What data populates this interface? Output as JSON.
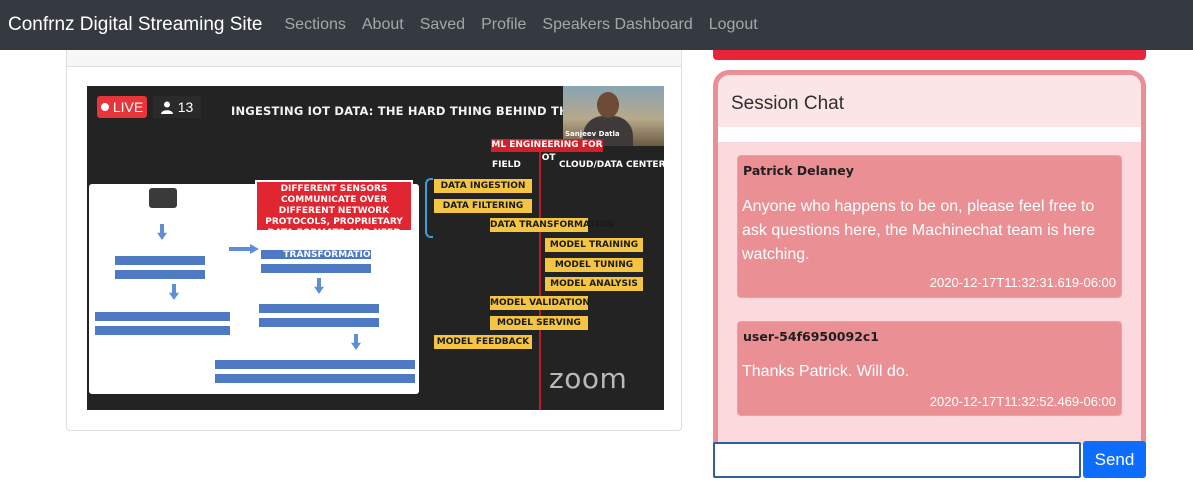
{
  "navbar": {
    "brand": "Confrnz Digital Streaming Site",
    "links": [
      "Sections",
      "About",
      "Saved",
      "Profile",
      "Speakers Dashboard",
      "Logout"
    ]
  },
  "video": {
    "live_label": "LIVE",
    "viewer_icon": "person-icon",
    "viewer_count": "13",
    "slide_title": "INGESTING IOT DATA: THE HARD THING BEHIND THE SMART THINGS",
    "speaker_name": "Sanjeev Datla",
    "ml_header": "ML ENGINEERING FOR IOT",
    "col_field": "FIELD",
    "col_cloud": "CLOUD/DATA CENTER",
    "callout": "DIFFERENT SENSORS COMMUNICATE OVER DIFFERENT NETWORK PROTOCOLS, PROPRIETARY DATA FORMATS AND NEED CUSTOM DATA TRANSFORMATIONS",
    "steps": [
      "DATA INGESTION",
      "DATA FILTERING",
      "DATA TRANSFORMATION",
      "MODEL TRAINING",
      "MODEL TUNING",
      "MODEL ANALYSIS",
      "MODEL VALIDATION",
      "MODEL SERVING",
      "MODEL FEEDBACK"
    ],
    "zoom_logo": "zoom"
  },
  "chat": {
    "title": "Session Chat",
    "messages": [
      {
        "author": "Patrick Delaney",
        "text": "Anyone who happens to be on, please feel free to ask questions here, the Machinechat team is here watching.",
        "time": "2020-12-17T11:32:31.619-06:00"
      },
      {
        "author": "user-54f6950092c1",
        "text": "Thanks Patrick. Will do.",
        "time": "2020-12-17T11:32:52.469-06:00"
      }
    ],
    "input_value": "",
    "send_label": "Send"
  },
  "colors": {
    "navbar_bg": "#343a40",
    "accent_red": "#e8233a",
    "chat_border": "#e98f96",
    "message_bg": "#ea9095",
    "send_button": "#0d6efd"
  }
}
